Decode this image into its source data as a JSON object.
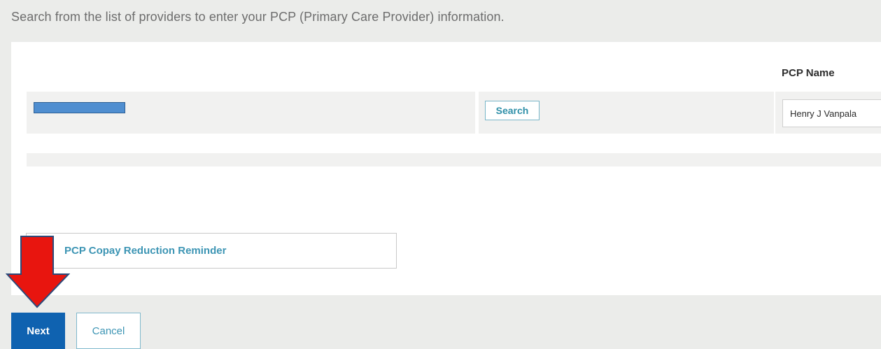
{
  "instruction": "Search from the list of providers to enter your PCP (Primary Care Provider) information.",
  "table": {
    "pcp_name_header": "PCP Name",
    "search_button": "Search",
    "pcp_name_value": "Henry J Vanpala"
  },
  "reminder": {
    "link_label": "PCP Copay Reduction Reminder"
  },
  "footer": {
    "next_label": "Next",
    "cancel_label": "Cancel"
  },
  "colors": {
    "primary_button": "#0f62b0",
    "link": "#3d95b4",
    "redaction": "#4f8ed0",
    "arrow": "#e8150f"
  },
  "icons": {
    "annotation_arrow": "down-arrow-icon"
  }
}
